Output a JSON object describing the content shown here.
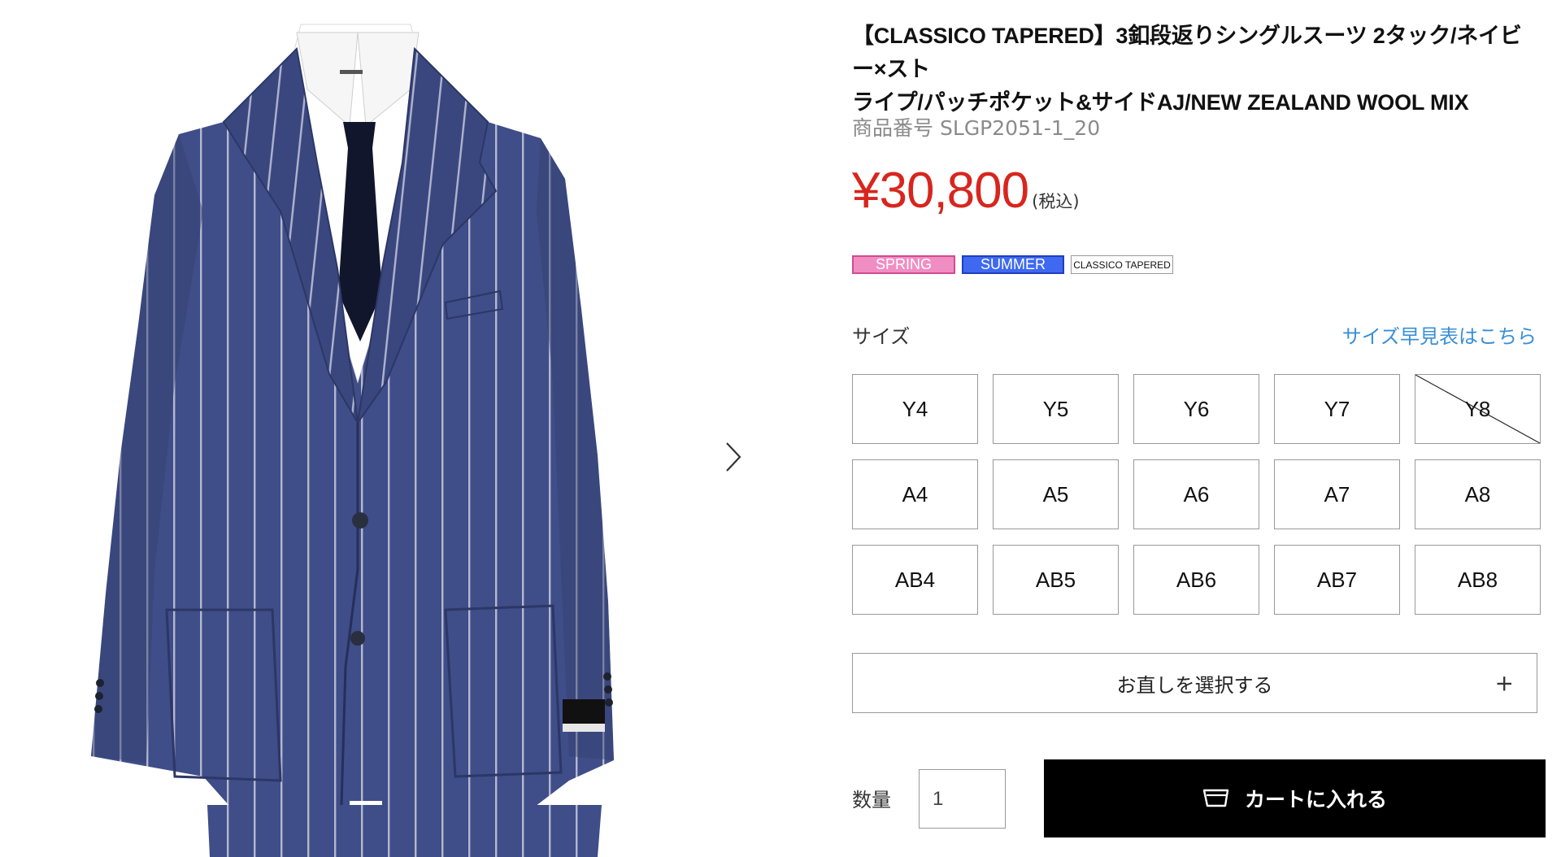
{
  "product": {
    "title_line1": "【CLASSICO TAPERED】3釦段返りシングルスーツ 2タック/ネイビー×スト",
    "title_line2": "ライプ/パッチポケット&サイドAJ/NEW ZEALAND WOOL MIX",
    "item_code_label": "商品番号",
    "item_code": "SLGP2051-1_20",
    "price": "¥30,800",
    "tax_note": "(税込)"
  },
  "tags": [
    {
      "label": "SPRING",
      "color": "#f08ec4"
    },
    {
      "label": "SUMMER",
      "color": "#3e69f0"
    },
    {
      "label": "CLASSICO TAPERED",
      "color": "#ffffff"
    }
  ],
  "size": {
    "label": "サイズ",
    "chart_link": "サイズ早見表はこちら",
    "rows": [
      [
        {
          "label": "Y4",
          "sold_out": false
        },
        {
          "label": "Y5",
          "sold_out": false
        },
        {
          "label": "Y6",
          "sold_out": false
        },
        {
          "label": "Y7",
          "sold_out": false
        },
        {
          "label": "Y8",
          "sold_out": true
        }
      ],
      [
        {
          "label": "A4",
          "sold_out": false
        },
        {
          "label": "A5",
          "sold_out": false
        },
        {
          "label": "A6",
          "sold_out": false
        },
        {
          "label": "A7",
          "sold_out": false
        },
        {
          "label": "A8",
          "sold_out": false
        }
      ],
      [
        {
          "label": "AB4",
          "sold_out": false
        },
        {
          "label": "AB5",
          "sold_out": false
        },
        {
          "label": "AB6",
          "sold_out": false
        },
        {
          "label": "AB7",
          "sold_out": false
        },
        {
          "label": "AB8",
          "sold_out": false
        }
      ]
    ]
  },
  "alteration": {
    "label": "お直しを選択する",
    "icon": "plus-icon"
  },
  "quantity": {
    "label": "数量",
    "value": "1"
  },
  "cart": {
    "label": "カートに入れる",
    "icon": "cart-icon"
  },
  "gallery": {
    "next_icon": "chevron-right-icon",
    "image_subject": "navy-pinstripe-suit-jacket"
  },
  "colors": {
    "price": "#d7261e",
    "link": "#3a8fd6",
    "cart_bg": "#000000",
    "suit_navy": "#3d4a85"
  }
}
